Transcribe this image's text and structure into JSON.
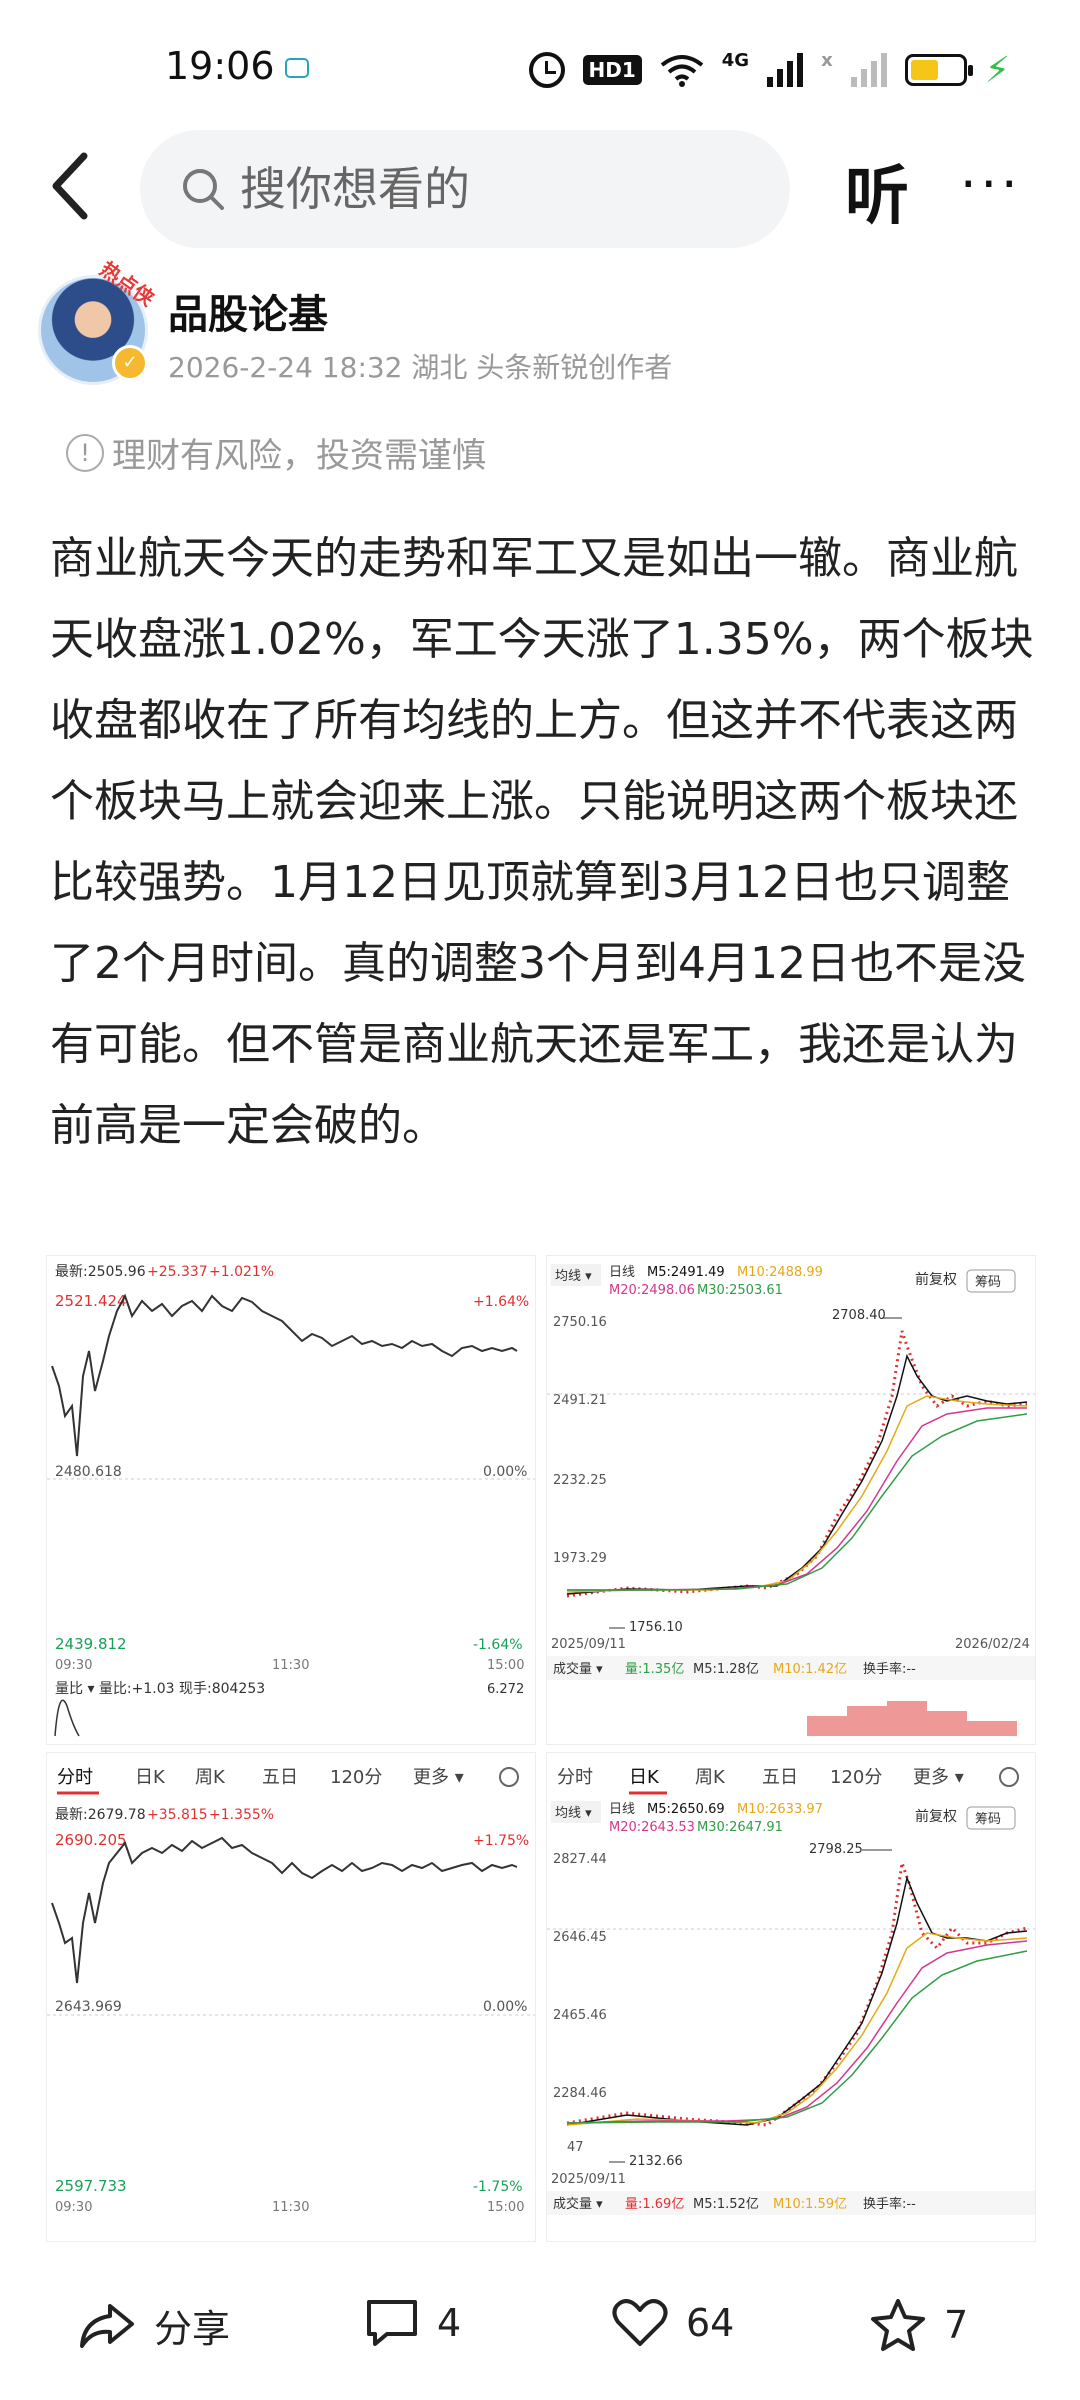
{
  "status_bar": {
    "time": "19:06",
    "network_label": "4G",
    "network_label_2": "x",
    "hd_label": "HD1"
  },
  "nav": {
    "search_placeholder": "搜你想看的",
    "listen_label": "听",
    "more_label": "···"
  },
  "author": {
    "avatar_tag": "热点侠",
    "name": "品股论基",
    "meta": "2026-2-24 18:32 湖北 头条新锐创作者"
  },
  "risk_note": "理财有风险，投资需谨慎",
  "article": "商业航天今天的走势和军工又是如出一辙。商业航天收盘涨1.02%，军工今天涨了1.35%，两个板块收盘都收在了所有均线的上方。但这并不代表这两个板块马上就会迎来上涨。只能说明这两个板块还比较强势。1月12日见顶就算到3月12日也只调整了2个月时间。真的调整3个月到4月12日也不是没有可能。但不管是商业航天还是军工，我还是认为前高是一定会破的。",
  "images": {
    "img1": {
      "latest": "最新:2505.96",
      "change": "+25.337",
      "pct": "+1.021%",
      "top_price": "2521.424",
      "top_pct": "+1.64%",
      "mid_price": "2480.618",
      "mid_pct": "0.00%",
      "bottom_price": "2439.812",
      "bottom_pct": "-1.64%",
      "time_start": "09:30",
      "time_mid": "11:30",
      "time_end": "15:00",
      "footer": "量比 ▾  量比:+1.03  现手:804253",
      "footer_right": "6.272"
    },
    "img2": {
      "ma_label": "均线 ▾",
      "period": "日线",
      "m5": "M5:2491.49",
      "m10": "M10:2488.99",
      "m20": "M20:2498.06",
      "m30": "M30:2503.61",
      "fq": "前复权",
      "chip": "筹码",
      "peak_label": "2708.40",
      "y1": "2750.16",
      "y2": "2491.21",
      "y3": "2232.25",
      "y4": "1973.29",
      "low_label": "1756.10",
      "date_start": "2025/09/11",
      "date_end": "2026/02/24",
      "vol_label": "成交量 ▾",
      "vol": "量:1.35亿",
      "vol_m5": "M5:1.28亿",
      "vol_m10": "M10:1.42亿",
      "turnover": "换手率:--"
    },
    "img3": {
      "tabs": [
        "分时",
        "日K",
        "周K",
        "五日",
        "120分",
        "更多 ▾"
      ],
      "latest": "最新:2679.78",
      "change": "+35.815",
      "pct": "+1.355%",
      "top_price": "2690.205",
      "top_pct": "+1.75%",
      "mid_price": "2643.969",
      "mid_pct": "0.00%",
      "bottom_price": "2597.733",
      "bottom_pct": "-1.75%",
      "time_start": "09:30",
      "time_mid": "11:30",
      "time_end": "15:00"
    },
    "img4": {
      "tabs": [
        "分时",
        "日K",
        "周K",
        "五日",
        "120分",
        "更多 ▾"
      ],
      "ma_label": "均线 ▾",
      "period": "日线",
      "m5": "M5:2650.69",
      "m10": "M10:2633.97",
      "m20": "M20:2643.53",
      "m30": "M30:2647.91",
      "fq": "前复权",
      "chip": "筹码",
      "peak_label": "2798.25",
      "y1": "2827.44",
      "y2": "2646.45",
      "y3": "2465.46",
      "y4": "2284.46",
      "y5": "47",
      "low_label": "2132.66",
      "date_start": "2025/09/11",
      "vol_label": "成交量 ▾",
      "vol": "量:1.69亿",
      "vol_m5": "M5:1.52亿",
      "vol_m10": "M10:1.59亿",
      "turnover": "换手率:--"
    }
  },
  "actions": {
    "share": "分享",
    "comments": "4",
    "likes": "64",
    "favorites": "7"
  },
  "colors": {
    "up": "#e03131",
    "down": "#18a058",
    "ma5": "#111111",
    "ma10": "#e6a817",
    "ma20": "#d6368e",
    "ma30": "#2f9e44"
  }
}
